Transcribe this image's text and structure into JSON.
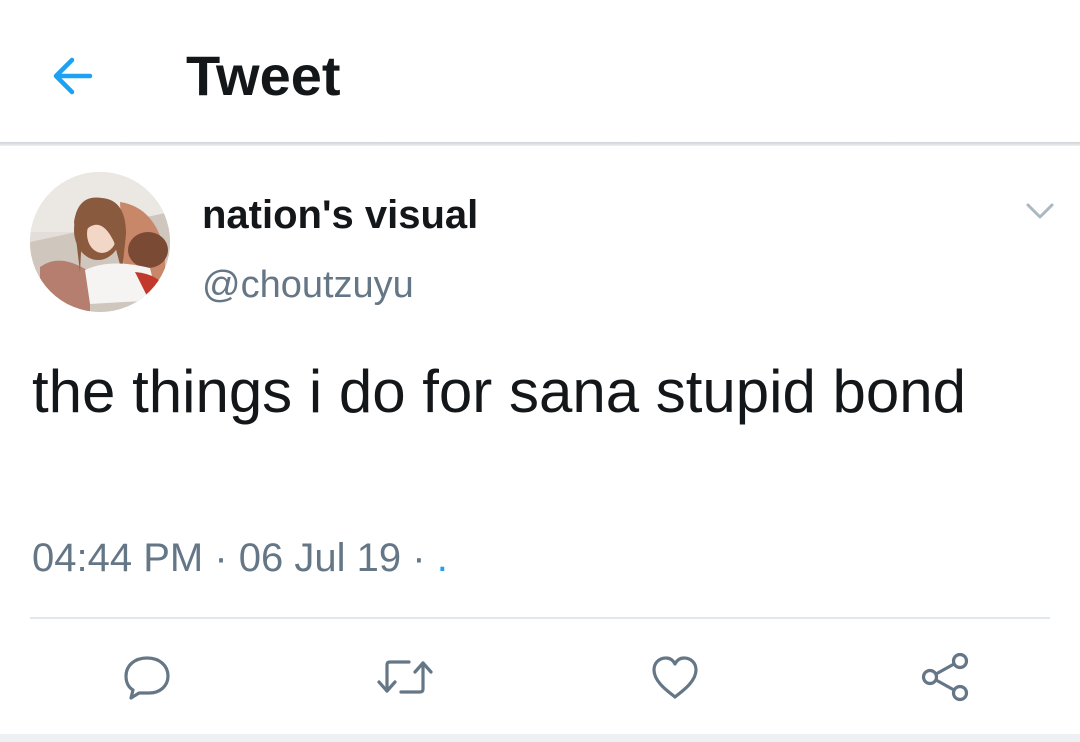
{
  "header": {
    "title": "Tweet",
    "back_icon": "arrow-left-icon",
    "accent_color": "#1da1f2"
  },
  "tweet": {
    "display_name": "nation's visual",
    "handle": "@choutzuyu",
    "text": "the things i do for sana stupid bond",
    "time": "04:44 PM",
    "date": "06 Jul 19",
    "separator": "·",
    "source": ".",
    "menu_icon": "chevron-down-icon"
  },
  "actions": [
    {
      "name": "reply",
      "icon": "reply-icon"
    },
    {
      "name": "retweet",
      "icon": "retweet-icon"
    },
    {
      "name": "like",
      "icon": "heart-icon"
    },
    {
      "name": "share",
      "icon": "share-icon"
    }
  ],
  "colors": {
    "primary_text": "#14171a",
    "secondary_text": "#657786",
    "accent": "#1da1f2",
    "divider": "#e1e8ed"
  }
}
